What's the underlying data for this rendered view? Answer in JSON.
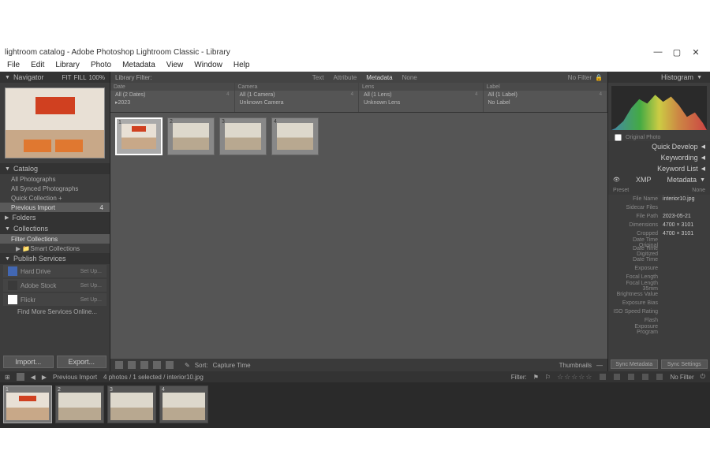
{
  "window": {
    "title": "lightroom catalog - Adobe Photoshop Lightroom Classic - Library"
  },
  "menu": [
    "File",
    "Edit",
    "Library",
    "Photo",
    "Metadata",
    "View",
    "Window",
    "Help"
  ],
  "left": {
    "navigator": "Navigator",
    "nav_opts": [
      "FIT",
      "FILL",
      "100%"
    ],
    "catalog": "Catalog",
    "catalog_items": [
      "All Photographs",
      "All Synced Photographs",
      "Quick Collection +",
      "Previous Import"
    ],
    "folders": "Folders",
    "collections": "Collections",
    "col_items": [
      "Filter Collections",
      "Smart Collections"
    ],
    "publish": "Publish Services",
    "pub_items": [
      {
        "name": "Hard Drive",
        "setup": "Set Up..."
      },
      {
        "name": "Adobe Stock",
        "setup": "Set Up..."
      },
      {
        "name": "Flickr",
        "setup": "Set Up..."
      }
    ],
    "find_more": "Find More Services Online...",
    "import": "Import...",
    "export": "Export..."
  },
  "filter": {
    "label": "Library Filter:",
    "tabs": [
      "Text",
      "Attribute",
      "Metadata",
      "None"
    ],
    "active": "Metadata",
    "nofilter": "No Filter",
    "cols": [
      {
        "hdr": "Date",
        "rows": [
          {
            "t": "All (2 Dates)",
            "c": "4"
          },
          {
            "t": "2023",
            "c": ""
          }
        ]
      },
      {
        "hdr": "Camera",
        "rows": [
          {
            "t": "All (1 Camera)",
            "c": "4"
          },
          {
            "t": "Unknown Camera",
            "c": ""
          }
        ]
      },
      {
        "hdr": "Lens",
        "rows": [
          {
            "t": "All (1 Lens)",
            "c": "4"
          },
          {
            "t": "Unknown Lens",
            "c": ""
          }
        ]
      },
      {
        "hdr": "Label",
        "rows": [
          {
            "t": "All (1 Label)",
            "c": "4"
          },
          {
            "t": "No Label",
            "c": ""
          }
        ]
      }
    ]
  },
  "toolbar": {
    "sort": "Sort:",
    "sortval": "Capture Time",
    "thumbnails": "Thumbnails"
  },
  "film": {
    "breadcrumb": "Previous Import",
    "count": "4 photos / 1 selected / interior10.jpg",
    "filter": "Filter:",
    "nofilter": "No Filter"
  },
  "right": {
    "histogram": "Histogram",
    "original": "Original Photo",
    "quickdev": "Quick Develop",
    "keywording": "Keywording",
    "keywordlist": "Keyword List",
    "metadata": "Metadata",
    "xmp": "XMP",
    "preset": "Preset",
    "preset_val": "None",
    "rows": [
      {
        "k": "File Name",
        "v": "interior10.jpg"
      },
      {
        "k": "Sidecar Files",
        "v": ""
      },
      {
        "k": "File Path",
        "v": "2023-05-21"
      },
      {
        "k": "Dimensions",
        "v": "4700 × 3101"
      },
      {
        "k": "Cropped",
        "v": "4700 × 3101"
      },
      {
        "k": "Date Time Original",
        "v": ""
      },
      {
        "k": "Date Time Digitized",
        "v": ""
      },
      {
        "k": "Date Time",
        "v": ""
      },
      {
        "k": "Exposure",
        "v": ""
      },
      {
        "k": "Focal Length",
        "v": ""
      },
      {
        "k": "Focal Length 35mm",
        "v": ""
      },
      {
        "k": "Brightness Value",
        "v": ""
      },
      {
        "k": "Exposure Bias",
        "v": ""
      },
      {
        "k": "ISO Speed Rating",
        "v": ""
      },
      {
        "k": "Flash",
        "v": ""
      },
      {
        "k": "Exposure Program",
        "v": ""
      }
    ],
    "sync": "Sync Metadata",
    "syncset": "Sync Settings"
  }
}
